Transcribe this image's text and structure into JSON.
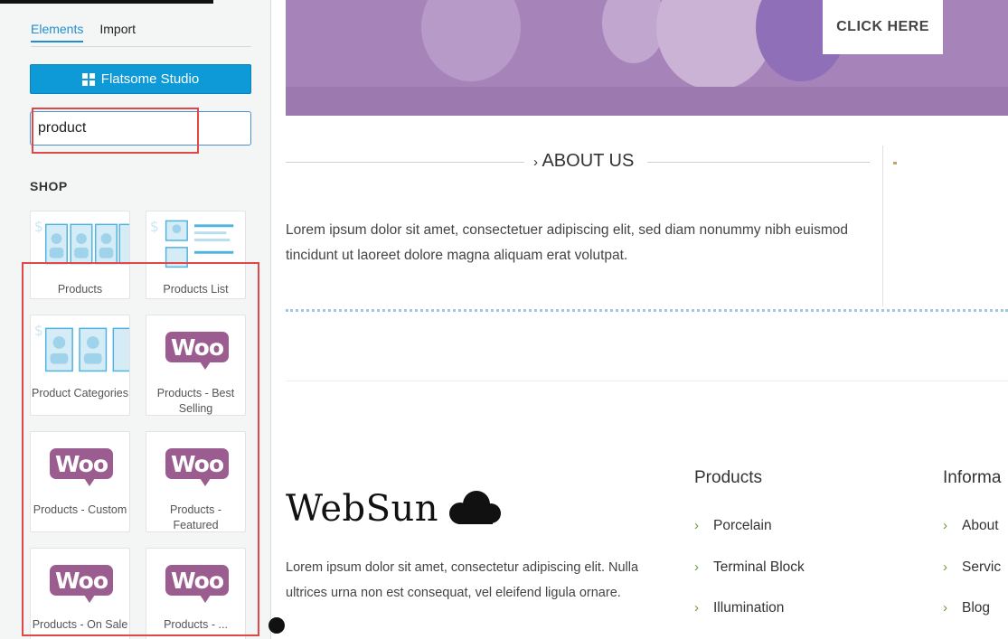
{
  "sidebar": {
    "tabs": [
      {
        "label": "Elements",
        "active": true
      },
      {
        "label": "Import",
        "active": false
      }
    ],
    "studio_button": "Flatsome Studio",
    "search": {
      "value": "product",
      "placeholder": ""
    },
    "section_heading": "SHOP",
    "cards": [
      {
        "label": "Products",
        "thumb": "products-grid"
      },
      {
        "label": "Products List",
        "thumb": "products-list"
      },
      {
        "label": "Product Categories",
        "thumb": "product-categories"
      },
      {
        "label": "Products - Best Selling",
        "thumb": "woo"
      },
      {
        "label": "Products - Custom",
        "thumb": "woo"
      },
      {
        "label": "Products - Featured",
        "thumb": "woo"
      },
      {
        "label": "Products - On Sale",
        "thumb": "woo"
      },
      {
        "label": "Products - ...",
        "thumb": "woo"
      }
    ],
    "woo_text": "Woo"
  },
  "main": {
    "cta": "CLICK HERE",
    "about": {
      "title": "ABOUT US",
      "text": "Lorem ipsum dolor sit amet, consectetuer adipiscing elit, sed diam nonummy nibh euismod tincidunt ut laoreet dolore magna aliquam erat volutpat."
    },
    "footer": {
      "logo": "WebSun",
      "text": "Lorem ipsum dolor sit amet, consectetur adipiscing elit. Nulla ultrices urna non est consequat, vel eleifend ligula ornare.",
      "columns": [
        {
          "title": "Products",
          "links": [
            "Porcelain",
            "Terminal Block",
            "Illumination"
          ]
        },
        {
          "title": "Informa",
          "links": [
            "About",
            "Servic",
            "Blog"
          ]
        }
      ]
    }
  },
  "colors": {
    "accent": "#0d9ad6",
    "hero": "#a683b9",
    "woo": "#9b5c8f",
    "highlight": "#e04848",
    "link_chevron": "#6a9b3a"
  }
}
